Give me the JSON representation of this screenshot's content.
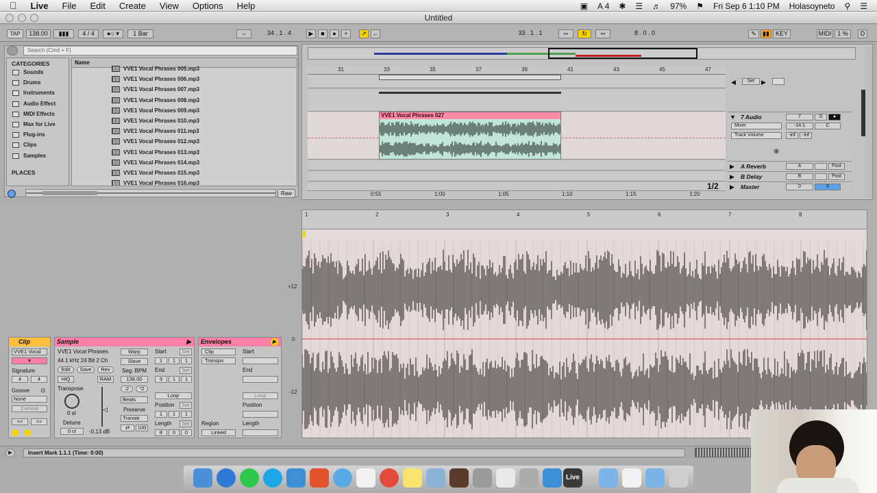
{
  "menubar": {
    "apple": "",
    "items": [
      "Live",
      "File",
      "Edit",
      "Create",
      "View",
      "Options",
      "Help"
    ],
    "status_icons": [
      "A 4"
    ],
    "battery": "97%",
    "clock": "Fri Sep 6  1:10 PM",
    "user": "Holasoyneto"
  },
  "window": {
    "title": "Untitled"
  },
  "control_bar": {
    "tap": "TAP",
    "tempo": "138.00",
    "meter": "4 / 4",
    "quant": "1 Bar",
    "position": "34 .  1 .  4",
    "loop_start": "33 .  1 .  1",
    "loop_len": "8 .  0 .  0",
    "key": "KEY",
    "midi": "MIDI",
    "cpu": "1 %",
    "d": "D"
  },
  "browser": {
    "search_placeholder": "Search (Cmd + F)",
    "categories_header": "CATEGORIES",
    "categories": [
      "Sounds",
      "Drums",
      "Instruments",
      "Audio Effect",
      "MIDI Effects",
      "Max for Live",
      "Plug-ins",
      "Clips",
      "Samples"
    ],
    "places_header": "PLACES",
    "name_header": "Name",
    "files": [
      "VVE1 Vocal Phrases 005.mp3",
      "VVE1 Vocal Phrases 006.mp3",
      "VVE1 Vocal Phrases 007.mp3",
      "VVE1 Vocal Phrases 008.mp3",
      "VVE1 Vocal Phrases 009.mp3",
      "VVE1 Vocal Phrases 010.mp3",
      "VVE1 Vocal Phrases 011.mp3",
      "VVE1 Vocal Phrases 012.mp3",
      "VVE1 Vocal Phrases 013.mp3",
      "VVE1 Vocal Phrases 014.mp3",
      "VVE1 Vocal Phrases 015.mp3",
      "VVE1 Vocal Phrases 016.mp3"
    ],
    "raw": "Raw"
  },
  "arrangement": {
    "bar_ruler": [
      "31",
      "33",
      "35",
      "37",
      "39",
      "41",
      "43",
      "45",
      "47"
    ],
    "time_ruler": [
      "0:55",
      "1:00",
      "1:05",
      "1:10",
      "1:15",
      "1:20"
    ],
    "clip_name": "VVE1 Vocal Phrases 027",
    "set_label": "Set",
    "zoom_frac": "1/2",
    "tracks": {
      "audio": {
        "name": "7 Audio",
        "number": "7",
        "solo": "S",
        "mixer": "Mixer",
        "track_volume": "Track Volume",
        "vol": "-14.1",
        "pan": "C",
        "inf1": "-inf",
        "inf2": "-inf"
      },
      "reverb": {
        "name": "A Reverb",
        "letter": "A",
        "post": "Post"
      },
      "delay": {
        "name": "B Delay",
        "letter": "B",
        "post": "Post"
      },
      "master": {
        "name": "Master",
        "num": "0",
        "num2": "0"
      }
    }
  },
  "clip_panel": {
    "title": "Clip",
    "name": "VVE1 Vocal",
    "signature": "Signature",
    "sig_num": "4",
    "sig_den": "4",
    "groove": "Groove",
    "groove_val": "None",
    "commit": "Commit"
  },
  "sample_panel": {
    "title": "Sample",
    "name": "VVE1 Vocal Phrases",
    "info": "44.1 kHz 24 Bit 2 Ch",
    "edit": "Edit",
    "save": "Save",
    "rev": "Rev",
    "hiq": "HiQ",
    "ram": "RAM",
    "transpose": "Transpose",
    "transpose_val": "0 st",
    "detune": "Detune",
    "detune_val": "0 ct",
    "gain": "-0.13 dB",
    "warp": "Warp",
    "slave": "Slave",
    "seg_bpm": "Seg. BPM",
    "bpm": "138.00",
    "half": ":2",
    "double": "*2",
    "mode": "Beats",
    "preserve": "Preserve",
    "preserve_val": "Transie",
    "amt": "100",
    "start": "Start",
    "end": "End",
    "loop": "Loop",
    "position": "Position",
    "length": "Length",
    "set": "Set",
    "start_vals": [
      "1",
      "1",
      "1"
    ],
    "end_vals": [
      "9",
      "1",
      "1"
    ],
    "pos_vals": [
      "1",
      "1",
      "1"
    ],
    "len_vals": [
      "8",
      "0",
      "0"
    ]
  },
  "envelope_panel": {
    "title": "Envelopes",
    "clip": "Clip",
    "transp": "Transpo",
    "region": "Region",
    "linked": "Linked",
    "start": "Start",
    "end": "End",
    "loop": "Loop",
    "position": "Position",
    "length": "Length"
  },
  "sample_editor": {
    "bars": [
      "1",
      "2",
      "3",
      "4",
      "5",
      "6",
      "7",
      "8"
    ],
    "db_top": "+12",
    "db_mid": "0",
    "db_bot": "-12"
  },
  "status": {
    "text": "Insert Mark 1.1.1 (Time: 0:00)"
  },
  "colors": {
    "clip_pink": "#ff8aa6",
    "yellow": "#f5d200",
    "orange": "#ffa21e",
    "wave_dark": "#1a1a1a",
    "clip_green": "#bfe6d6"
  }
}
